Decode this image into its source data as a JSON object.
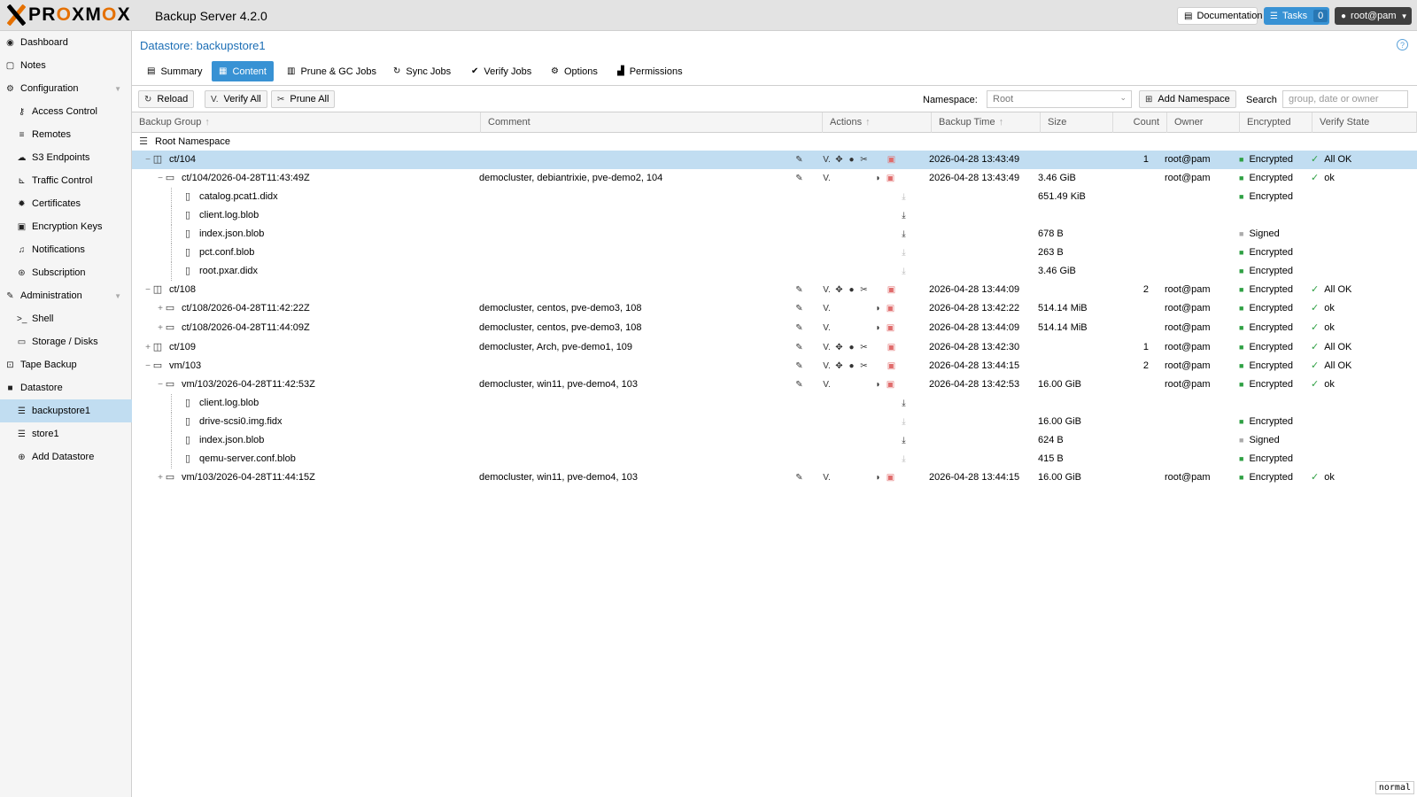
{
  "header": {
    "logo_word_left": "PR",
    "logo_word_o1": "O",
    "logo_word_mid": "XM",
    "logo_word_o2": "O",
    "logo_word_end": "X",
    "product": "Backup Server 4.2.0",
    "documentation": "Documentation",
    "tasks": "Tasks",
    "tasks_count": "0",
    "user": "root@pam"
  },
  "sidebar": {
    "items": [
      {
        "label": "Dashboard",
        "icon": "dashboard-icon"
      },
      {
        "label": "Notes",
        "icon": "notes-icon"
      },
      {
        "label": "Configuration",
        "icon": "cogs-icon"
      },
      {
        "label": "Access Control",
        "icon": "key-icon"
      },
      {
        "label": "Remotes",
        "icon": "server-icon"
      },
      {
        "label": "S3 Endpoints",
        "icon": "cloud-icon"
      },
      {
        "label": "Traffic Control",
        "icon": "chart-icon"
      },
      {
        "label": "Certificates",
        "icon": "certificate-icon"
      },
      {
        "label": "Encryption Keys",
        "icon": "lock-icon"
      },
      {
        "label": "Notifications",
        "icon": "bell-icon"
      },
      {
        "label": "Subscription",
        "icon": "support-icon"
      },
      {
        "label": "Administration",
        "icon": "wrench-icon"
      },
      {
        "label": "Shell",
        "icon": "terminal-icon"
      },
      {
        "label": "Storage / Disks",
        "icon": "hdd-icon"
      },
      {
        "label": "Tape Backup",
        "icon": "tape-icon"
      },
      {
        "label": "Datastore",
        "icon": "archive-icon"
      },
      {
        "label": "backupstore1",
        "icon": "database-icon"
      },
      {
        "label": "store1",
        "icon": "database-icon"
      },
      {
        "label": "Add Datastore",
        "icon": "plus-circle-icon"
      }
    ]
  },
  "main": {
    "title": "Datastore: backupstore1",
    "tabs": [
      "Summary",
      "Content",
      "Prune & GC Jobs",
      "Sync Jobs",
      "Verify Jobs",
      "Options",
      "Permissions"
    ],
    "toolbar": {
      "reload": "Reload",
      "verify_all": "Verify All",
      "prune_all": "Prune All",
      "namespace_label": "Namespace:",
      "namespace_value": "Root",
      "add_namespace": "Add Namespace",
      "search_label": "Search",
      "search_placeholder": "group, date or owner"
    },
    "columns": [
      "Backup Group",
      "Comment",
      "Actions",
      "Backup Time",
      "Size",
      "Count",
      "Owner",
      "Encrypted",
      "Verify State"
    ],
    "rows": [
      {
        "name": "Root Namespace",
        "comment": "",
        "time": "",
        "size": "",
        "count": "",
        "owner": "",
        "enc": "",
        "verify": ""
      },
      {
        "name": "ct/104",
        "comment": "",
        "time": "2026-04-28 13:43:49",
        "size": "",
        "count": "1",
        "owner": "root@pam",
        "enc": "Encrypted",
        "verify": "All OK"
      },
      {
        "name": "ct/104/2026-04-28T11:43:49Z",
        "comment": "democluster, debiantrixie, pve-demo2, 104",
        "time": "2026-04-28 13:43:49",
        "size": "3.46 GiB",
        "count": "",
        "owner": "root@pam",
        "enc": "Encrypted",
        "verify": "ok"
      },
      {
        "name": "catalog.pcat1.didx",
        "comment": "",
        "time": "",
        "size": "651.49 KiB",
        "count": "",
        "owner": "",
        "enc": "Encrypted",
        "verify": ""
      },
      {
        "name": "client.log.blob",
        "comment": "",
        "time": "",
        "size": "",
        "count": "",
        "owner": "",
        "enc": "",
        "verify": ""
      },
      {
        "name": "index.json.blob",
        "comment": "",
        "time": "",
        "size": "678 B",
        "count": "",
        "owner": "",
        "enc": "Signed",
        "verify": ""
      },
      {
        "name": "pct.conf.blob",
        "comment": "",
        "time": "",
        "size": "263 B",
        "count": "",
        "owner": "",
        "enc": "Encrypted",
        "verify": ""
      },
      {
        "name": "root.pxar.didx",
        "comment": "",
        "time": "",
        "size": "3.46 GiB",
        "count": "",
        "owner": "",
        "enc": "Encrypted",
        "verify": ""
      },
      {
        "name": "ct/108",
        "comment": "",
        "time": "2026-04-28 13:44:09",
        "size": "",
        "count": "2",
        "owner": "root@pam",
        "enc": "Encrypted",
        "verify": "All OK"
      },
      {
        "name": "ct/108/2026-04-28T11:42:22Z",
        "comment": "democluster, centos, pve-demo3, 108",
        "time": "2026-04-28 13:42:22",
        "size": "514.14 MiB",
        "count": "",
        "owner": "root@pam",
        "enc": "Encrypted",
        "verify": "ok"
      },
      {
        "name": "ct/108/2026-04-28T11:44:09Z",
        "comment": "democluster, centos, pve-demo3, 108",
        "time": "2026-04-28 13:44:09",
        "size": "514.14 MiB",
        "count": "",
        "owner": "root@pam",
        "enc": "Encrypted",
        "verify": "ok"
      },
      {
        "name": "ct/109",
        "comment": "democluster, Arch, pve-demo1, 109",
        "time": "2026-04-28 13:42:30",
        "size": "",
        "count": "1",
        "owner": "root@pam",
        "enc": "Encrypted",
        "verify": "All OK"
      },
      {
        "name": "vm/103",
        "comment": "",
        "time": "2026-04-28 13:44:15",
        "size": "",
        "count": "2",
        "owner": "root@pam",
        "enc": "Encrypted",
        "verify": "All OK"
      },
      {
        "name": "vm/103/2026-04-28T11:42:53Z",
        "comment": "democluster, win11, pve-demo4, 103",
        "time": "2026-04-28 13:42:53",
        "size": "16.00 GiB",
        "count": "",
        "owner": "root@pam",
        "enc": "Encrypted",
        "verify": "ok"
      },
      {
        "name": "client.log.blob",
        "comment": "",
        "time": "",
        "size": "",
        "count": "",
        "owner": "",
        "enc": "",
        "verify": ""
      },
      {
        "name": "drive-scsi0.img.fidx",
        "comment": "",
        "time": "",
        "size": "16.00 GiB",
        "count": "",
        "owner": "",
        "enc": "Encrypted",
        "verify": ""
      },
      {
        "name": "index.json.blob",
        "comment": "",
        "time": "",
        "size": "624 B",
        "count": "",
        "owner": "",
        "enc": "Signed",
        "verify": ""
      },
      {
        "name": "qemu-server.conf.blob",
        "comment": "",
        "time": "",
        "size": "415 B",
        "count": "",
        "owner": "",
        "enc": "Encrypted",
        "verify": ""
      },
      {
        "name": "vm/103/2026-04-28T11:44:15Z",
        "comment": "democluster, win11, pve-demo4, 103",
        "time": "2026-04-28 13:44:15",
        "size": "16.00 GiB",
        "count": "",
        "owner": "root@pam",
        "enc": "Encrypted",
        "verify": "ok"
      }
    ]
  },
  "mode_badge": "normal",
  "colors": {
    "accent": "#3892d4",
    "selected": "#c1ddf1",
    "logo_orange": "#e57000",
    "ok_green": "#2ea043",
    "delete_red": "#e06c6c"
  }
}
